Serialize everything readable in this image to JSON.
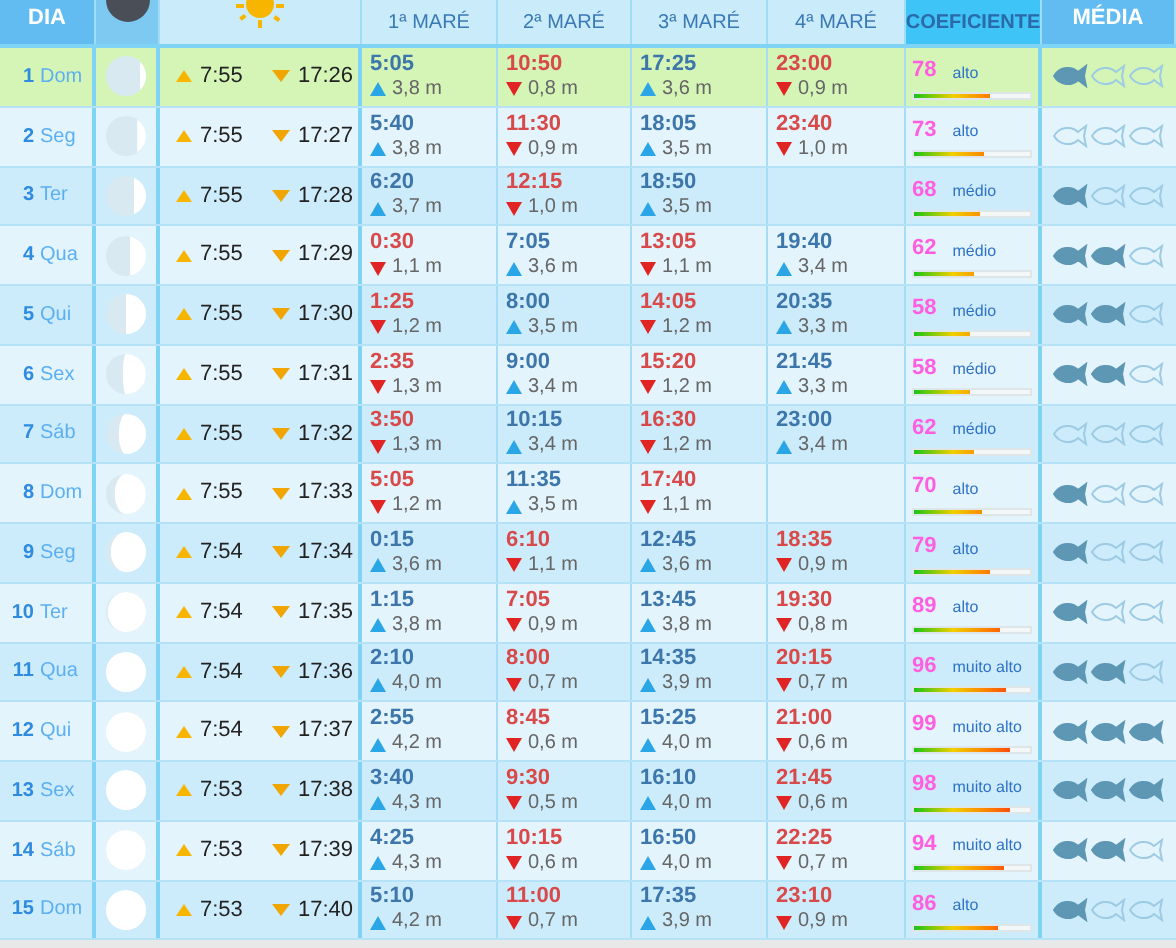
{
  "columns": [
    {
      "kind": "day",
      "label": "DIA"
    },
    {
      "kind": "moon"
    },
    {
      "kind": "sun"
    },
    {
      "kind": "tide",
      "label": "1ª MARÉ"
    },
    {
      "kind": "tide",
      "label": "2ª MARÉ"
    },
    {
      "kind": "tide",
      "label": "3ª MARÉ"
    },
    {
      "kind": "tide",
      "label": "4ª MARÉ"
    },
    {
      "kind": "coefficient",
      "label": "COEFICIENTE"
    },
    {
      "kind": "average",
      "label": "MÉDIA"
    }
  ],
  "rows": [
    {
      "day": "1",
      "weekday": "Dom",
      "selected": true,
      "moon": {
        "level": 0.15
      },
      "sunrise": "7:55",
      "sunset": "17:26",
      "tides": [
        {
          "kind": "high",
          "time": "5:05",
          "height": "3,8 m"
        },
        {
          "kind": "low",
          "time": "10:50",
          "height": "0,8 m"
        },
        {
          "kind": "high",
          "time": "17:25",
          "height": "3,6 m"
        },
        {
          "kind": "low",
          "time": "23:00",
          "height": "0,9 m"
        }
      ],
      "coefficient": "78",
      "rating": "alto",
      "level": 0.65,
      "stars": 1
    },
    {
      "day": "2",
      "weekday": "Seg",
      "selected": false,
      "moon": {
        "level": 0.22
      },
      "sunrise": "7:55",
      "sunset": "17:27",
      "tides": [
        {
          "kind": "high",
          "time": "5:40",
          "height": "3,8 m"
        },
        {
          "kind": "low",
          "time": "11:30",
          "height": "0,9 m"
        },
        {
          "kind": "high",
          "time": "18:05",
          "height": "3,5 m"
        },
        {
          "kind": "low",
          "time": "23:40",
          "height": "1,0 m"
        }
      ],
      "coefficient": "73",
      "rating": "alto",
      "level": 0.61,
      "stars": 0
    },
    {
      "day": "3",
      "weekday": "Ter",
      "selected": false,
      "moon": {
        "level": 0.3
      },
      "sunrise": "7:55",
      "sunset": "17:28",
      "tides": [
        {
          "kind": "high",
          "time": "6:20",
          "height": "3,7 m"
        },
        {
          "kind": "low",
          "time": "12:15",
          "height": "1,0 m"
        },
        {
          "kind": "high",
          "time": "18:50",
          "height": "3,5 m"
        }
      ],
      "coefficient": "68",
      "rating": "médio",
      "level": 0.57,
      "stars": 1
    },
    {
      "day": "4",
      "weekday": "Qua",
      "selected": false,
      "moon": {
        "level": 0.4
      },
      "sunrise": "7:55",
      "sunset": "17:29",
      "tides": [
        {
          "kind": "low",
          "time": "0:30",
          "height": "1,1 m"
        },
        {
          "kind": "high",
          "time": "7:05",
          "height": "3,6 m"
        },
        {
          "kind": "low",
          "time": "13:05",
          "height": "1,1 m"
        },
        {
          "kind": "high",
          "time": "19:40",
          "height": "3,4 m"
        }
      ],
      "coefficient": "62",
      "rating": "médio",
      "level": 0.52,
      "stars": 2
    },
    {
      "day": "5",
      "weekday": "Qui",
      "selected": false,
      "moon": {
        "level": 0.5
      },
      "sunrise": "7:55",
      "sunset": "17:30",
      "tides": [
        {
          "kind": "low",
          "time": "1:25",
          "height": "1,2 m"
        },
        {
          "kind": "high",
          "time": "8:00",
          "height": "3,5 m"
        },
        {
          "kind": "low",
          "time": "14:05",
          "height": "1,2 m"
        },
        {
          "kind": "high",
          "time": "20:35",
          "height": "3,3 m"
        }
      ],
      "coefficient": "58",
      "rating": "médio",
      "level": 0.48,
      "stars": 2
    },
    {
      "day": "6",
      "weekday": "Sex",
      "selected": false,
      "moon": {
        "level": 0.58
      },
      "sunrise": "7:55",
      "sunset": "17:31",
      "tides": [
        {
          "kind": "low",
          "time": "2:35",
          "height": "1,3 m"
        },
        {
          "kind": "high",
          "time": "9:00",
          "height": "3,4 m"
        },
        {
          "kind": "low",
          "time": "15:20",
          "height": "1,2 m"
        },
        {
          "kind": "high",
          "time": "21:45",
          "height": "3,3 m"
        }
      ],
      "coefficient": "58",
      "rating": "médio",
      "level": 0.48,
      "stars": 2
    },
    {
      "day": "7",
      "weekday": "Sáb",
      "selected": false,
      "moon": {
        "level": 0.68
      },
      "sunrise": "7:55",
      "sunset": "17:32",
      "tides": [
        {
          "kind": "low",
          "time": "3:50",
          "height": "1,3 m"
        },
        {
          "kind": "high",
          "time": "10:15",
          "height": "3,4 m"
        },
        {
          "kind": "low",
          "time": "16:30",
          "height": "1,2 m"
        },
        {
          "kind": "high",
          "time": "23:00",
          "height": "3,4 m"
        }
      ],
      "coefficient": "62",
      "rating": "médio",
      "level": 0.52,
      "stars": 0
    },
    {
      "day": "8",
      "weekday": "Dom",
      "selected": false,
      "moon": {
        "level": 0.78
      },
      "sunrise": "7:55",
      "sunset": "17:33",
      "tides": [
        {
          "kind": "low",
          "time": "5:05",
          "height": "1,2 m"
        },
        {
          "kind": "high",
          "time": "11:35",
          "height": "3,5 m"
        },
        {
          "kind": "low",
          "time": "17:40",
          "height": "1,1 m"
        }
      ],
      "coefficient": "70",
      "rating": "alto",
      "level": 0.58,
      "stars": 1
    },
    {
      "day": "9",
      "weekday": "Seg",
      "selected": false,
      "moon": {
        "level": 0.88
      },
      "sunrise": "7:54",
      "sunset": "17:34",
      "tides": [
        {
          "kind": "high",
          "time": "0:15",
          "height": "3,6 m"
        },
        {
          "kind": "low",
          "time": "6:10",
          "height": "1,1 m"
        },
        {
          "kind": "high",
          "time": "12:45",
          "height": "3,6 m"
        },
        {
          "kind": "low",
          "time": "18:35",
          "height": "0,9 m"
        }
      ],
      "coefficient": "79",
      "rating": "alto",
      "level": 0.66,
      "stars": 1
    },
    {
      "day": "10",
      "weekday": "Ter",
      "selected": false,
      "moon": {
        "level": 0.96
      },
      "sunrise": "7:54",
      "sunset": "17:35",
      "tides": [
        {
          "kind": "high",
          "time": "1:15",
          "height": "3,8 m"
        },
        {
          "kind": "low",
          "time": "7:05",
          "height": "0,9 m"
        },
        {
          "kind": "high",
          "time": "13:45",
          "height": "3,8 m"
        },
        {
          "kind": "low",
          "time": "19:30",
          "height": "0,8 m"
        }
      ],
      "coefficient": "89",
      "rating": "alto",
      "level": 0.74,
      "stars": 1
    },
    {
      "day": "11",
      "weekday": "Qua",
      "selected": false,
      "moon": {
        "level": 1
      },
      "sunrise": "7:54",
      "sunset": "17:36",
      "tides": [
        {
          "kind": "high",
          "time": "2:10",
          "height": "4,0 m"
        },
        {
          "kind": "low",
          "time": "8:00",
          "height": "0,7 m"
        },
        {
          "kind": "high",
          "time": "14:35",
          "height": "3,9 m"
        },
        {
          "kind": "low",
          "time": "20:15",
          "height": "0,7 m"
        }
      ],
      "coefficient": "96",
      "rating": "muito alto",
      "level": 0.8,
      "stars": 2
    },
    {
      "day": "12",
      "weekday": "Qui",
      "selected": false,
      "moon": {
        "level": 1
      },
      "sunrise": "7:54",
      "sunset": "17:37",
      "tides": [
        {
          "kind": "high",
          "time": "2:55",
          "height": "4,2 m"
        },
        {
          "kind": "low",
          "time": "8:45",
          "height": "0,6 m"
        },
        {
          "kind": "high",
          "time": "15:25",
          "height": "4,0 m"
        },
        {
          "kind": "low",
          "time": "21:00",
          "height": "0,6 m"
        }
      ],
      "coefficient": "99",
      "rating": "muito alto",
      "level": 0.83,
      "stars": 3
    },
    {
      "day": "13",
      "weekday": "Sex",
      "selected": false,
      "moon": {
        "level": 1
      },
      "sunrise": "7:53",
      "sunset": "17:38",
      "tides": [
        {
          "kind": "high",
          "time": "3:40",
          "height": "4,3 m"
        },
        {
          "kind": "low",
          "time": "9:30",
          "height": "0,5 m"
        },
        {
          "kind": "high",
          "time": "16:10",
          "height": "4,0 m"
        },
        {
          "kind": "low",
          "time": "21:45",
          "height": "0,6 m"
        }
      ],
      "coefficient": "98",
      "rating": "muito alto",
      "level": 0.82,
      "stars": 3
    },
    {
      "day": "14",
      "weekday": "Sáb",
      "selected": false,
      "moon": {
        "level": 1
      },
      "sunrise": "7:53",
      "sunset": "17:39",
      "tides": [
        {
          "kind": "high",
          "time": "4:25",
          "height": "4,3 m"
        },
        {
          "kind": "low",
          "time": "10:15",
          "height": "0,6 m"
        },
        {
          "kind": "high",
          "time": "16:50",
          "height": "4,0 m"
        },
        {
          "kind": "low",
          "time": "22:25",
          "height": "0,7 m"
        }
      ],
      "coefficient": "94",
      "rating": "muito alto",
      "level": 0.78,
      "stars": 2
    },
    {
      "day": "15",
      "weekday": "Dom",
      "selected": false,
      "moon": {
        "level": 1
      },
      "sunrise": "7:53",
      "sunset": "17:40",
      "tides": [
        {
          "kind": "high",
          "time": "5:10",
          "height": "4,2 m"
        },
        {
          "kind": "low",
          "time": "11:00",
          "height": "0,7 m"
        },
        {
          "kind": "high",
          "time": "17:35",
          "height": "3,9 m"
        },
        {
          "kind": "low",
          "time": "23:10",
          "height": "0,9 m"
        }
      ],
      "coefficient": "86",
      "rating": "alto",
      "level": 0.72,
      "stars": 1
    }
  ]
}
